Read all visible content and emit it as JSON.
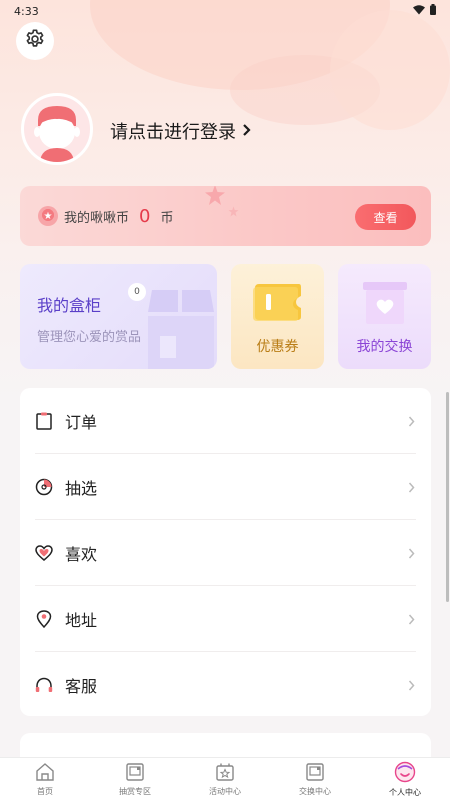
{
  "status_bar": {
    "time": "4:33"
  },
  "profile": {
    "login_prompt": "请点击进行登录"
  },
  "coins": {
    "label": "我的啾啾币",
    "value": "0",
    "unit": "币",
    "view_button": "查看"
  },
  "quick_cards": {
    "box": {
      "title": "我的盒柜",
      "badge": "0",
      "subtitle": "管理您心爱的赏品"
    },
    "coupon": {
      "label": "优惠券"
    },
    "exchange": {
      "label": "我的交换"
    }
  },
  "menu": {
    "items": [
      {
        "label": "订单",
        "icon": "clipboard-icon"
      },
      {
        "label": "抽选",
        "icon": "draw-icon"
      },
      {
        "label": "喜欢",
        "icon": "heart-icon"
      },
      {
        "label": "地址",
        "icon": "location-icon"
      },
      {
        "label": "客服",
        "icon": "headset-icon"
      }
    ]
  },
  "tab_bar": {
    "items": [
      {
        "label": "首页",
        "icon": "home-icon"
      },
      {
        "label": "抽赏专区",
        "icon": "prize-icon"
      },
      {
        "label": "活动中心",
        "icon": "event-icon"
      },
      {
        "label": "交换中心",
        "icon": "exchange-icon"
      },
      {
        "label": "个人中心",
        "icon": "profile-icon"
      }
    ],
    "active": "个人中心"
  },
  "colors": {
    "accent": "#f2585c",
    "coin_value": "#e53b4b",
    "box_title": "#5a3fc8",
    "coupon_label": "#b97d16",
    "exchange_label": "#8b45d6"
  }
}
